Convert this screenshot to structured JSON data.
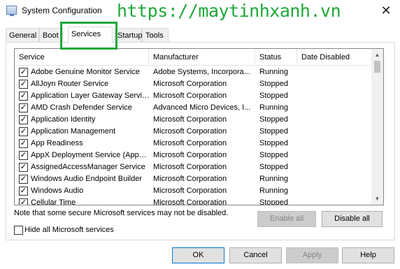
{
  "window": {
    "title": "System Configuration",
    "close_glyph": "✕",
    "watermark": "https://maytinhxanh.vn",
    "app_icon": "msconfig-icon"
  },
  "tabs": [
    {
      "label": "General"
    },
    {
      "label": "Boot"
    },
    {
      "label": "Services"
    },
    {
      "label": "Startup"
    },
    {
      "label": "Tools"
    }
  ],
  "active_tab": "Services",
  "services": {
    "columns": [
      "Service",
      "Manufacturer",
      "Status",
      "Date Disabled"
    ],
    "rows": [
      {
        "checked": true,
        "name": "Adobe Genuine Monitor Service",
        "manufacturer": "Adobe Systems, Incorpora...",
        "status": "Running",
        "date_disabled": ""
      },
      {
        "checked": true,
        "name": "AllJoyn Router Service",
        "manufacturer": "Microsoft Corporation",
        "status": "Stopped",
        "date_disabled": ""
      },
      {
        "checked": true,
        "name": "Application Layer Gateway Service",
        "manufacturer": "Microsoft Corporation",
        "status": "Stopped",
        "date_disabled": ""
      },
      {
        "checked": true,
        "name": "AMD Crash Defender Service",
        "manufacturer": "Advanced Micro Devices, I...",
        "status": "Running",
        "date_disabled": ""
      },
      {
        "checked": true,
        "name": "Application Identity",
        "manufacturer": "Microsoft Corporation",
        "status": "Stopped",
        "date_disabled": ""
      },
      {
        "checked": true,
        "name": "Application Management",
        "manufacturer": "Microsoft Corporation",
        "status": "Stopped",
        "date_disabled": ""
      },
      {
        "checked": true,
        "name": "App Readiness",
        "manufacturer": "Microsoft Corporation",
        "status": "Stopped",
        "date_disabled": ""
      },
      {
        "checked": true,
        "name": "AppX Deployment Service (AppX...",
        "manufacturer": "Microsoft Corporation",
        "status": "Stopped",
        "date_disabled": ""
      },
      {
        "checked": true,
        "name": "AssignedAccessManager Service",
        "manufacturer": "Microsoft Corporation",
        "status": "Stopped",
        "date_disabled": ""
      },
      {
        "checked": true,
        "name": "Windows Audio Endpoint Builder",
        "manufacturer": "Microsoft Corporation",
        "status": "Running",
        "date_disabled": ""
      },
      {
        "checked": true,
        "name": "Windows Audio",
        "manufacturer": "Microsoft Corporation",
        "status": "Running",
        "date_disabled": ""
      },
      {
        "checked": true,
        "name": "Cellular Time",
        "manufacturer": "Microsoft Corporation",
        "status": "Stopped",
        "date_disabled": ""
      }
    ],
    "check_glyph": "✓"
  },
  "scroll": {
    "up_glyph": "▲",
    "down_glyph": "▼"
  },
  "note": "Note that some secure Microsoft services may not be disabled.",
  "buttons": {
    "enable_all": "Enable all",
    "disable_all": "Disable all",
    "ok": "OK",
    "cancel": "Cancel",
    "apply": "Apply",
    "help": "Help"
  },
  "hide_ms": {
    "label": "Hide all Microsoft services",
    "checked": false
  },
  "colors": {
    "watermark": "#1fa83a",
    "highlight": "#1fa83a"
  }
}
